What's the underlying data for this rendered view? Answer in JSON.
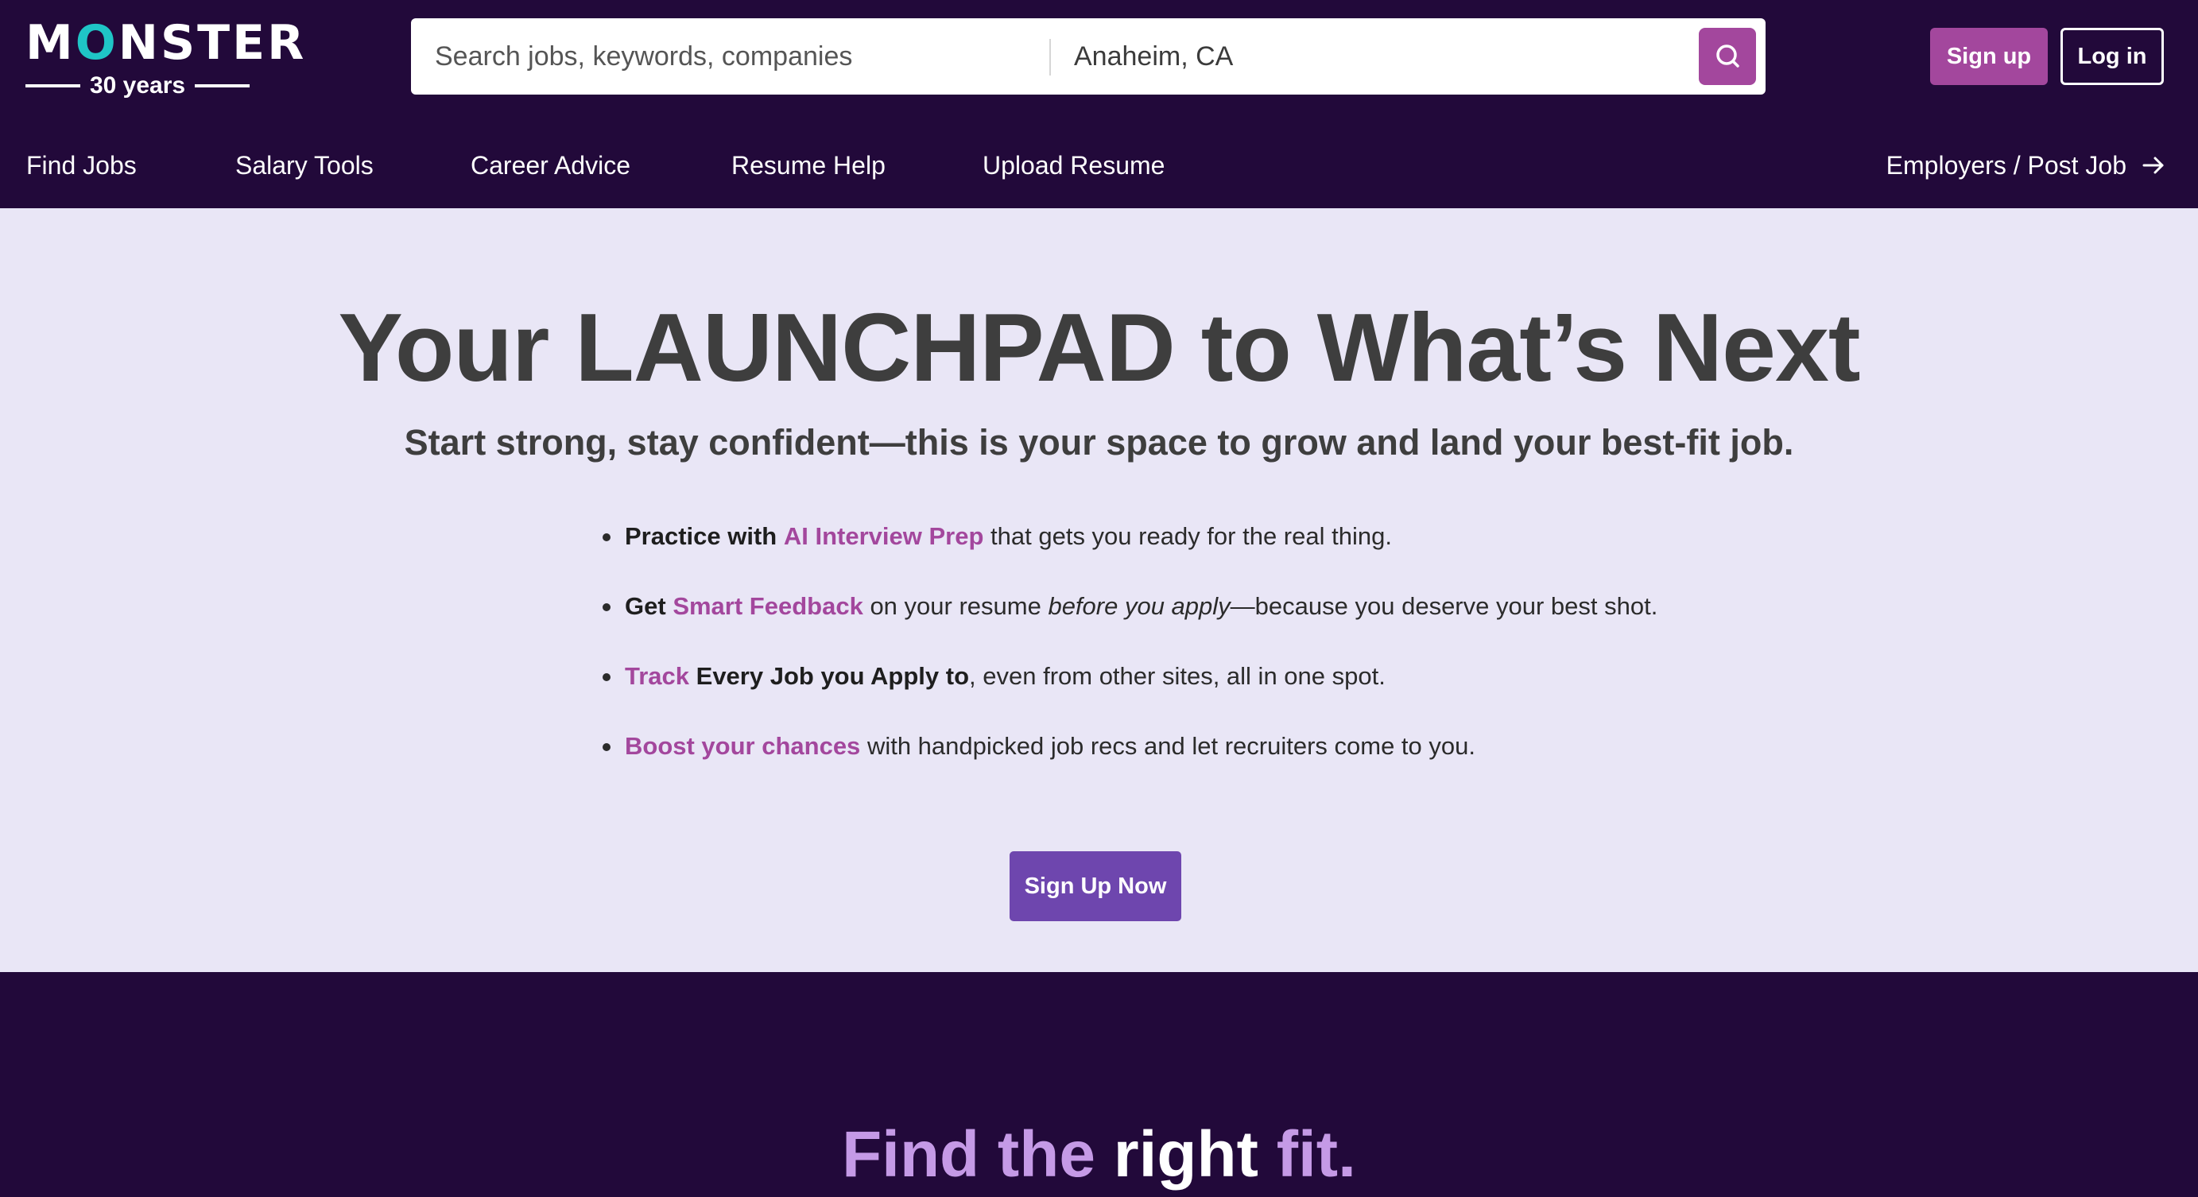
{
  "brand": {
    "logo_word": "MONSTER",
    "logo_tagline": "30 years",
    "colors": {
      "header_bg": "#22093a",
      "accent": "#a3479d",
      "cta": "#6e46ae",
      "hero_bg": "#e9e6f6"
    }
  },
  "search": {
    "keyword_placeholder": "Search jobs, keywords, companies",
    "location_value": "Anaheim, CA",
    "button_icon": "search-icon"
  },
  "auth": {
    "signup_label": "Sign up",
    "login_label": "Log in"
  },
  "nav": {
    "items": [
      {
        "label": "Find Jobs"
      },
      {
        "label": "Salary Tools"
      },
      {
        "label": "Career Advice"
      },
      {
        "label": "Resume Help"
      },
      {
        "label": "Upload Resume"
      }
    ],
    "employers_label": "Employers / Post Job",
    "employers_icon": "arrow-right-icon"
  },
  "hero": {
    "title": "Your LAUNCHPAD to What’s Next",
    "subtitle": "Start strong, stay confident—this is your space to grow and land your best-fit job.",
    "bullets": [
      {
        "lead": "Practice with",
        "link": "AI Interview Prep",
        "rest": "that gets you ready for the real thing."
      },
      {
        "lead": "Get",
        "link": "Smart Feedback",
        "mid": "on your resume",
        "em": "before you apply",
        "rest": "—because you deserve your best shot."
      },
      {
        "link": "Track",
        "lead": "Every Job you Apply to",
        "rest": ", even from other sites, all in one spot."
      },
      {
        "link": "Boost your chances",
        "rest": "with handpicked job recs and let recruiters come to you."
      }
    ],
    "cta_label": "Sign Up Now"
  },
  "fit": {
    "part1": "Find the",
    "part2": "right",
    "part3": "fit."
  }
}
